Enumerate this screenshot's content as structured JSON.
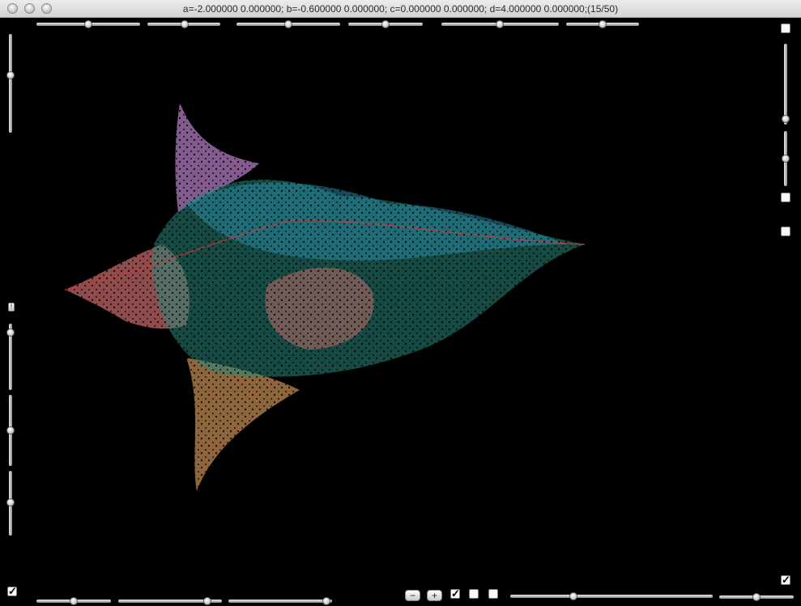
{
  "window": {
    "title": "a=-2.000000 0.000000; b=-0.600000 0.000000; c=0.000000 0.000000; d=4.000000 0.000000;(15/50)"
  },
  "controls": {
    "top_sliders": [
      {
        "name": "top-slider-1",
        "value": 0.48
      },
      {
        "name": "top-slider-2",
        "value": 0.5
      },
      {
        "name": "top-slider-3",
        "value": 0.5
      },
      {
        "name": "top-slider-4",
        "value": 0.5
      },
      {
        "name": "top-slider-5",
        "value": 0.5
      },
      {
        "name": "top-slider-6",
        "value": 0.5
      }
    ],
    "left_sliders": [
      {
        "name": "left-slider-1",
        "value": 0.42
      },
      {
        "name": "left-slider-2",
        "value": 0.1
      },
      {
        "name": "left-slider-3",
        "value": 0.5
      },
      {
        "name": "left-slider-4",
        "value": 0.5
      }
    ],
    "right_sliders": [
      {
        "name": "right-slider-1",
        "value": 0.93
      },
      {
        "name": "right-slider-2",
        "value": 0.5
      }
    ],
    "bottom_sliders": [
      {
        "name": "bottom-slider-1",
        "value": 0.5
      },
      {
        "name": "bottom-slider-2",
        "value": 0.75
      },
      {
        "name": "bottom-slider-3",
        "value": 0.97
      },
      {
        "name": "bottom-slider-4",
        "value": 0.3
      },
      {
        "name": "bottom-slider-5",
        "value": 0.5
      }
    ],
    "buttons": {
      "minus_label": "−",
      "plus_label": "+",
      "small_label": "!"
    },
    "checkboxes": {
      "top_right": {
        "checked": false
      },
      "right_middle": {
        "checked": false
      },
      "right_lower": {
        "checked": false
      },
      "bottom_left": {
        "checked": true
      },
      "bottom_center_1": {
        "checked": true
      },
      "bottom_center_2": {
        "checked": false
      },
      "bottom_center_3": {
        "checked": false
      },
      "bottom_right": {
        "checked": true
      },
      "check_glyph": "✓"
    }
  },
  "canvas": {
    "background": "#000000",
    "colors": {
      "pink": "#f08080",
      "violet": "#d090e0",
      "teal": "#30a090",
      "blue": "#30a0c0",
      "orange": "#e0a060",
      "red": "#ff4040"
    }
  }
}
